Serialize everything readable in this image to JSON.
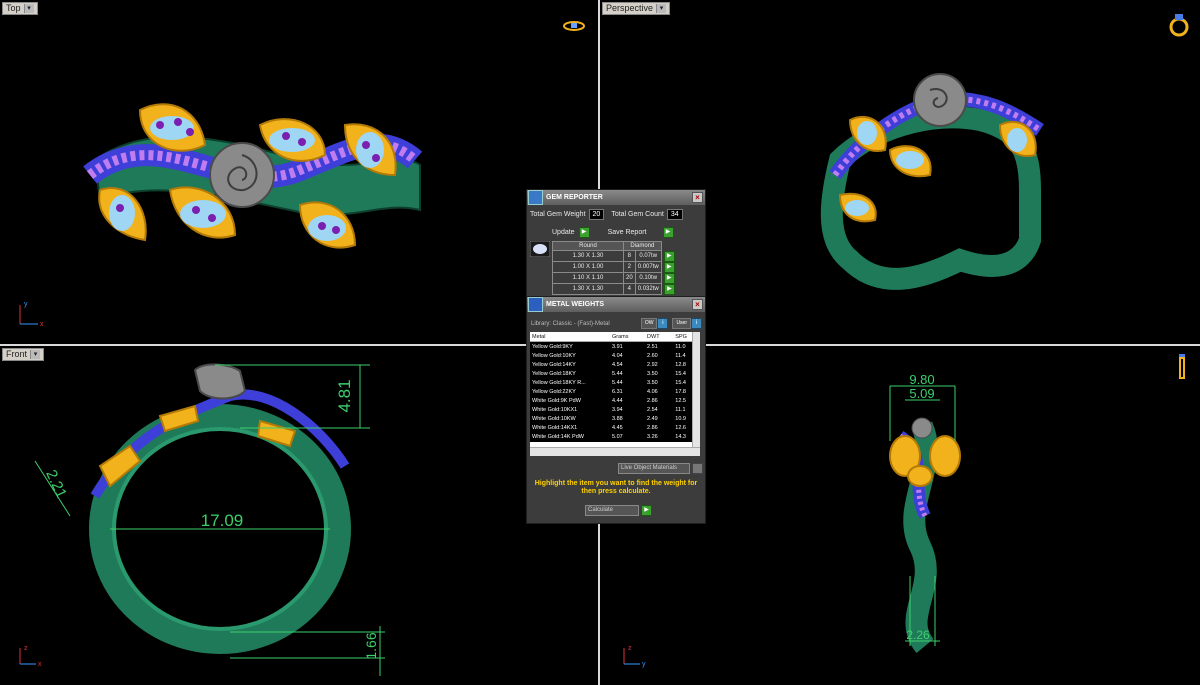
{
  "viewports": {
    "top": {
      "label": "Top"
    },
    "perspective": {
      "label": "Perspective"
    },
    "front": {
      "label": "Front"
    },
    "right": {
      "label": ""
    }
  },
  "dimensions": {
    "front_height": "4.81",
    "front_band": "2.21",
    "front_inner_diameter": "17.09",
    "front_shank_bottom": "1.66",
    "right_width_outer": "9.80",
    "right_width_inner": "5.09",
    "right_shank_bottom": "2.26"
  },
  "axes": {
    "x": "x",
    "y": "y",
    "z": "z"
  },
  "gem_reporter": {
    "title": "Gem Reporter",
    "total_weight_label": "Total Gem Weight",
    "total_weight_value": "20",
    "total_count_label": "Total Gem Count",
    "total_count_value": "34",
    "update_label": "Update",
    "save_label": "Save Report",
    "header_shape": "Round",
    "header_type": "Diamond",
    "rows": [
      {
        "size": "1.30 X 1.30",
        "count": "8",
        "weight": "0.07tw"
      },
      {
        "size": "1.00 X 1.00",
        "count": "2",
        "weight": "0.007tw"
      },
      {
        "size": "1.10 X 1.10",
        "count": "20",
        "weight": "0.10tw"
      },
      {
        "size": "1.30 X 1.30",
        "count": "4",
        "weight": "0.032tw"
      }
    ]
  },
  "metal_weights": {
    "title": "Metal Weights",
    "library": "Library: Classic - (Fast)-Metal",
    "btn_ow": "OW",
    "btn_user": "User",
    "columns": [
      "Metal",
      "Grams",
      "DWT",
      "SPG"
    ],
    "rows": [
      {
        "metal": "Yellow Gold:9KY",
        "grams": "3.91",
        "dwt": "2.51",
        "spg": "11.0"
      },
      {
        "metal": "Yellow Gold:10KY",
        "grams": "4.04",
        "dwt": "2.60",
        "spg": "11.4"
      },
      {
        "metal": "Yellow Gold:14KY",
        "grams": "4.54",
        "dwt": "2.92",
        "spg": "12.8"
      },
      {
        "metal": "Yellow Gold:18KY",
        "grams": "5.44",
        "dwt": "3.50",
        "spg": "15.4"
      },
      {
        "metal": "Yellow Gold:18KY R...",
        "grams": "5.44",
        "dwt": "3.50",
        "spg": "15.4"
      },
      {
        "metal": "Yellow Gold:22KY",
        "grams": "6.31",
        "dwt": "4.06",
        "spg": "17.8"
      },
      {
        "metal": "White Gold:9K PdW",
        "grams": "4.44",
        "dwt": "2.86",
        "spg": "12.5"
      },
      {
        "metal": "White Gold:10KX1",
        "grams": "3.94",
        "dwt": "2.54",
        "spg": "11.1"
      },
      {
        "metal": "White Gold:10KW",
        "grams": "3.88",
        "dwt": "2.49",
        "spg": "10.9"
      },
      {
        "metal": "White Gold:14KX1",
        "grams": "4.45",
        "dwt": "2.86",
        "spg": "12.6"
      },
      {
        "metal": "White Gold:14K PdW",
        "grams": "5.07",
        "dwt": "3.26",
        "spg": "14.3"
      }
    ],
    "live_materials": "Live Object Materials",
    "hint": "Highlight the item you want to find the weight for then press calculate.",
    "calc_label": "Calculate"
  },
  "colors": {
    "shank": "#1f7a5a",
    "gold": "#f2b21b",
    "stone": "#9fd6f4",
    "pave": "#6b2fd0",
    "rose": "#8a8a8a",
    "dim": "#3cd06c"
  }
}
